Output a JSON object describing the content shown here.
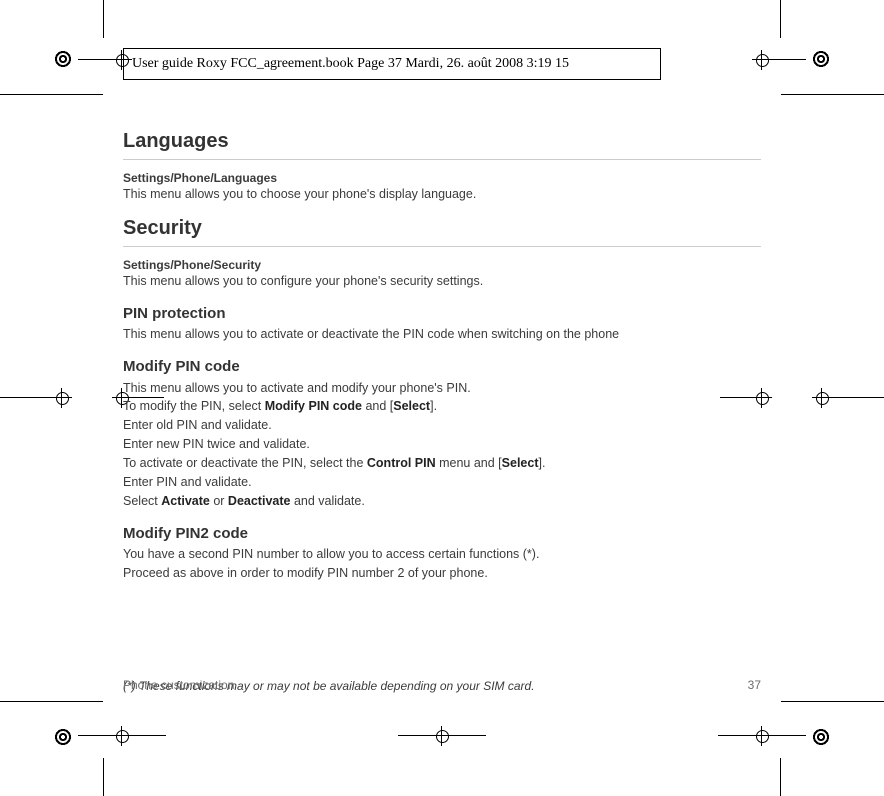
{
  "header": {
    "text": "User guide Roxy FCC_agreement.book  Page 37  Mardi, 26. août 2008  3:19 15"
  },
  "sections": {
    "languages": {
      "title": "Languages",
      "path": "Settings/Phone/Languages",
      "desc": "This menu allows you to choose your phone's display language."
    },
    "security": {
      "title": "Security",
      "path": "Settings/Phone/Security",
      "desc": "This menu allows you to configure your phone's security settings."
    },
    "pin_protection": {
      "title": "PIN protection",
      "desc": "This menu allows you to activate or deactivate the PIN code when switching on the phone"
    },
    "modify_pin": {
      "title": "Modify PIN code",
      "l1": "This menu allows you to activate and modify your phone's PIN.",
      "l2a": "To modify the PIN, select ",
      "l2b": "Modify PIN code",
      "l2c": " and [",
      "l2d": "Select",
      "l2e": "].",
      "l3": "Enter old PIN and validate.",
      "l4": "Enter new PIN twice and validate.",
      "l5a": "To activate or deactivate the PIN, select the ",
      "l5b": "Control PIN",
      "l5c": " menu and [",
      "l5d": "Select",
      "l5e": "].",
      "l6": "Enter PIN and validate.",
      "l7a": "Select ",
      "l7b": "Activate",
      "l7c": " or ",
      "l7d": "Deactivate",
      "l7e": " and validate."
    },
    "modify_pin2": {
      "title": "Modify PIN2 code",
      "l1": "You have a second PIN number to allow you to access certain functions (*).",
      "l2": "Proceed as above in order to modify PIN number 2 of your phone."
    }
  },
  "footnote": "(*)    These functions may or may not be available depending on your SIM card.",
  "footer": {
    "left": "Phone customization",
    "right": "37"
  }
}
